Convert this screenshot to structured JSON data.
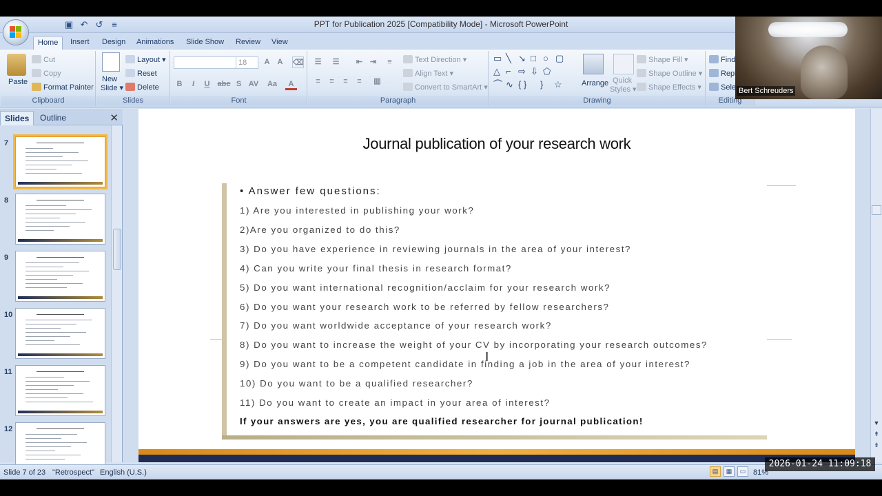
{
  "window": {
    "title": "PPT for Publication 2025 [Compatibility Mode] - Microsoft PowerPoint"
  },
  "qat": [
    {
      "icon": "save-icon",
      "glyph": "▣"
    },
    {
      "icon": "undo-icon",
      "glyph": "↶"
    },
    {
      "icon": "redo-icon",
      "glyph": "↺"
    },
    {
      "icon": "customize-qat-icon",
      "glyph": "≡"
    }
  ],
  "tabs": [
    "Home",
    "Insert",
    "Design",
    "Animations",
    "Slide Show",
    "Review",
    "View"
  ],
  "ribbon": {
    "clipboard": {
      "label": "Clipboard",
      "paste": "Paste",
      "cut": "Cut",
      "copy": "Copy",
      "format_painter": "Format Painter"
    },
    "slides": {
      "label": "Slides",
      "new_slide": "New",
      "new_slide2": "Slide ▾",
      "layout": "Layout ▾",
      "reset": "Reset",
      "delete": "Delete"
    },
    "font": {
      "label": "Font",
      "font_name": "",
      "font_size": "18"
    },
    "paragraph": {
      "label": "Paragraph",
      "text_direction": "Text Direction ▾",
      "align_text": "Align Text ▾",
      "convert": "Convert to SmartArt ▾"
    },
    "drawing": {
      "label": "Drawing",
      "arrange": "Arrange",
      "quick_styles": "Quick",
      "quick_styles2": "Styles ▾",
      "shape_fill": "Shape Fill ▾",
      "shape_outline": "Shape Outline ▾",
      "shape_effects": "Shape Effects ▾"
    },
    "editing": {
      "label": "Editing",
      "find": "Find",
      "replace": "Repl",
      "select": "Sele"
    }
  },
  "panel": {
    "tab_slides": "Slides",
    "tab_outline": "Outline",
    "close": "✕"
  },
  "thumbnails": [
    {
      "num": "7",
      "selected": true
    },
    {
      "num": "8",
      "selected": false
    },
    {
      "num": "9",
      "selected": false
    },
    {
      "num": "10",
      "selected": false
    },
    {
      "num": "11",
      "selected": false
    },
    {
      "num": "12",
      "selected": false
    }
  ],
  "slide": {
    "title": "Journal publication of your research work",
    "heading": "• Answer few questions:",
    "questions": [
      "1) Are you interested in publishing your work?",
      "2)Are you organized to do this?",
      "3) Do you have experience in reviewing journals in the area of your interest?",
      "4) Can you write your final thesis in research format?",
      "5) Do you want international recognition/acclaim for your research work?",
      "6) Do you want your research work to be referred by fellow researchers?",
      "7) Do you want worldwide acceptance of your research work?",
      "8) Do you want to increase the weight of your CV by incorporating your research outcomes?",
      "9) Do you want to be a competent candidate in finding a job in the area of your interest?",
      "10) Do you want to be a qualified researcher?",
      "11) Do you want to create an impact in your area of interest?"
    ],
    "conclusion": "If your answers are yes, you are qualified researcher for journal publication!"
  },
  "status": {
    "slide_of": "Slide 7 of 23",
    "theme": "\"Retrospect\"",
    "language": "English (U.S.)",
    "zoom": "81%"
  },
  "webcam": {
    "name": "Bert Schreuders"
  },
  "overlay": {
    "timestamp": "2026-01-24 11:09:18"
  },
  "colors": {
    "accent": "#f3b845",
    "ribbon": "#dde8f5",
    "slide_footer": "#1f2d55"
  }
}
